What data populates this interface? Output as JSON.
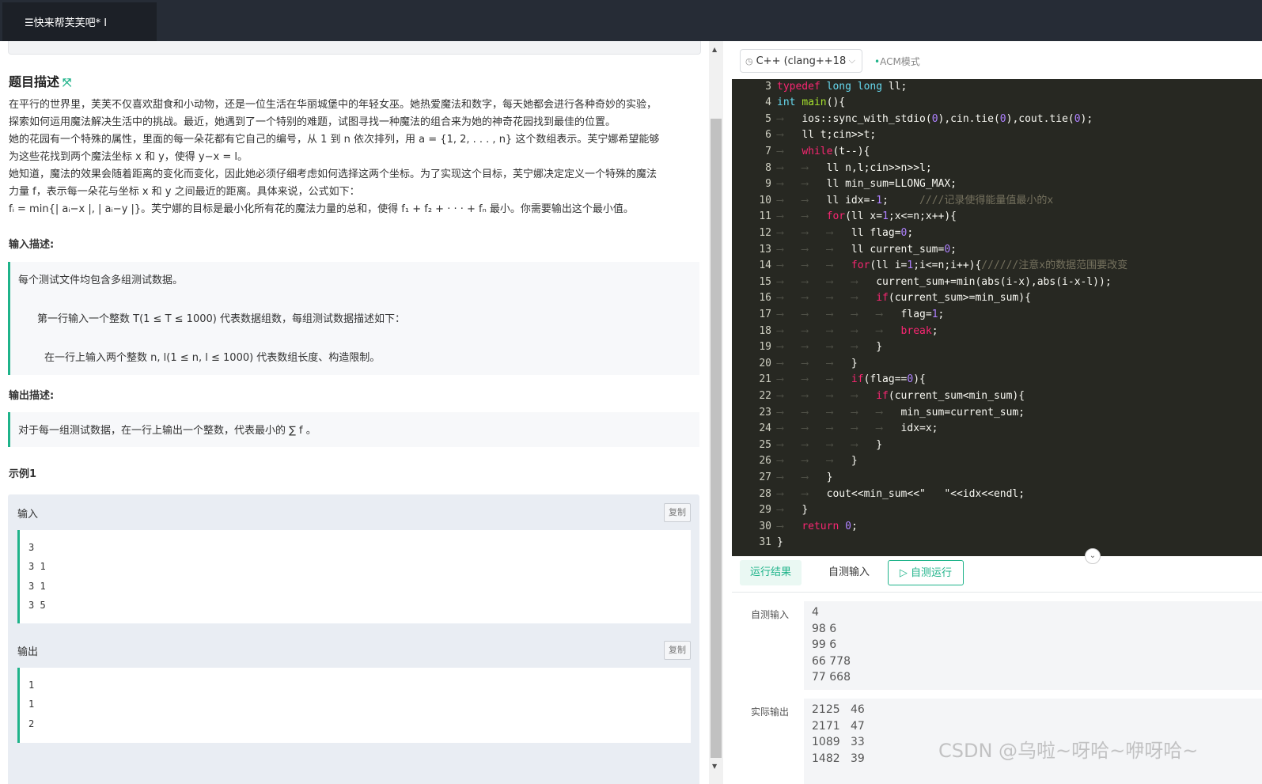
{
  "tab": {
    "title": "☰快来帮芙芙吧* I"
  },
  "problem": {
    "heading": "题目描述",
    "desc": [
      "在平行的世界里，芙芙不仅喜欢甜食和小动物，还是一位生活在华丽城堡中的年轻女巫。她热爱魔法和数字，每天她都会进行各种奇妙的实验，",
      "探索如何运用魔法解决生活中的挑战。最近，她遇到了一个特别的难题，试图寻找一种魔法的组合来为她的神奇花园找到最佳的位置。",
      "她的花园有一个特殊的属性，里面的每一朵花都有它自己的编号，从 1 到 n 依次排列，用 a = {1, 2, . . . , n} 这个数组表示。芙宁娜希望能够",
      "为这些花找到两个魔法坐标 x 和 y，使得 y−x = l。",
      "她知道，魔法的效果会随着距离的变化而变化，因此她必须仔细考虑如何选择这两个坐标。为了实现这个目标，芙宁娜决定定义一个特殊的魔法",
      "力量 f，表示每一朵花与坐标 x 和 y 之间最近的距离。具体来说，公式如下：",
      "fᵢ = min{| aᵢ−x |, | aᵢ−y |}。芙宁娜的目标是最小化所有花的魔法力量的总和，使得 f₁ + f₂ + · · · + fₙ 最小。你需要输出这个最小值。"
    ],
    "input_label": "输入描述:",
    "input_lines": [
      "每个测试文件均包含多组测试数据。",
      "第一行输入一个整数  T(1 ≤ T ≤ 1000)  代表数据组数，每组测试数据描述如下：",
      "在一行上输入两个整数  n, l(1 ≤ n, l ≤ 1000)  代表数组长度、构造限制。"
    ],
    "output_label": "输出描述:",
    "output_line": "对于每一组测试数据，在一行上输出一个整数，代表最小的  ∑ f  。",
    "example_label": "示例1",
    "example": {
      "input_label": "输入",
      "output_label": "输出",
      "copy_label": "复制",
      "input_lines": [
        "3",
        "3 1",
        "3 1",
        "3 5"
      ],
      "output_lines": [
        "1",
        "1",
        "2"
      ]
    }
  },
  "editor": {
    "language": "C++ (clang++18",
    "mode": "ACM模式",
    "lines": [
      {
        "n": "3"
      },
      {
        "n": "4"
      },
      {
        "n": "5"
      },
      {
        "n": "6"
      },
      {
        "n": "7"
      },
      {
        "n": "8"
      },
      {
        "n": "9"
      },
      {
        "n": "10"
      },
      {
        "n": "11"
      },
      {
        "n": "12"
      },
      {
        "n": "13"
      },
      {
        "n": "14"
      },
      {
        "n": "15"
      },
      {
        "n": "16"
      },
      {
        "n": "17"
      },
      {
        "n": "18"
      },
      {
        "n": "19"
      },
      {
        "n": "20"
      },
      {
        "n": "21"
      },
      {
        "n": "22"
      },
      {
        "n": "23"
      },
      {
        "n": "24"
      },
      {
        "n": "25"
      },
      {
        "n": "26"
      },
      {
        "n": "27"
      },
      {
        "n": "28"
      },
      {
        "n": "29"
      },
      {
        "n": "30"
      },
      {
        "n": "31"
      }
    ]
  },
  "result": {
    "tabs": [
      "运行结果",
      "自测输入",
      "▷ 自测运行"
    ],
    "self_input_label": "自测输入",
    "self_input": [
      "4",
      "98 6",
      "99 6",
      "66 778",
      "77 668"
    ],
    "actual_output_label": "实际输出",
    "actual_output": [
      "2125   46",
      "2171   47",
      "1089   33",
      "1482   39"
    ]
  },
  "watermark": "CSDN @乌啦~呀哈~咿呀哈~"
}
